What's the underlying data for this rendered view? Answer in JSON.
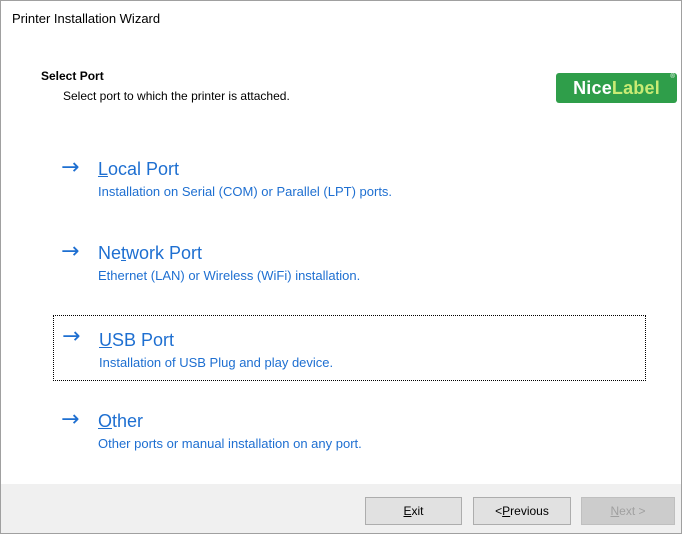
{
  "window": {
    "title": "Printer Installation Wizard"
  },
  "header": {
    "title": "Select Port",
    "subtitle": "Select port to which the printer is attached.",
    "logo": {
      "part1": "Nice",
      "part2": "Label",
      "mark": "®"
    }
  },
  "options": [
    {
      "icon": "arrow-right-icon",
      "arrow": "→",
      "accel": "L",
      "title_rest": "ocal Port",
      "description": "Installation on Serial (COM) or Parallel (LPT) ports.",
      "focused": false
    },
    {
      "icon": "arrow-right-icon",
      "arrow": "→",
      "title_pre": "Ne",
      "accel": "t",
      "title_rest": "work Port",
      "description": "Ethernet (LAN) or Wireless (WiFi) installation.",
      "focused": false
    },
    {
      "icon": "arrow-right-icon",
      "arrow": "→",
      "accel": "U",
      "title_rest": "SB Port",
      "description": "Installation of USB Plug and play device.",
      "focused": true
    },
    {
      "icon": "arrow-right-icon",
      "arrow": "→",
      "accel": "O",
      "title_rest": "ther",
      "description": "Other ports or manual installation on any port.",
      "focused": false
    }
  ],
  "footer": {
    "exit": {
      "accel": "E",
      "rest": "xit"
    },
    "previous": {
      "pre": "< ",
      "accel": "P",
      "rest": "revious"
    },
    "next": {
      "accel": "N",
      "rest": "ext >",
      "disabled": true
    }
  },
  "colors": {
    "link_blue": "#1e6fd1",
    "logo_green": "#2f9e4a",
    "logo_accent": "#c9eb74",
    "footer_bg": "#f0f0f0"
  }
}
